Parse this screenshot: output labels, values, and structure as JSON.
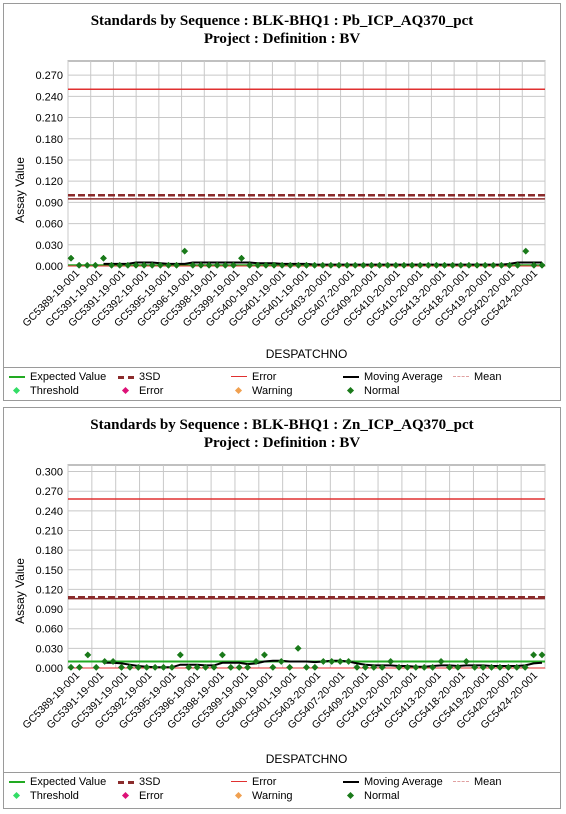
{
  "legend": {
    "expected_value": "Expected Value",
    "three_sd": "3SD",
    "error_line": "Error",
    "moving_average": "Moving Average",
    "mean": "Mean",
    "threshold": "Threshold",
    "error_marker": "Error",
    "warning": "Warning",
    "normal": "Normal"
  },
  "colors": {
    "expected_value": "#22aa22",
    "three_sd": "#8b2c2c",
    "error_line": "#e03030",
    "moving_average": "#000000",
    "mean": "#e0a0a0",
    "threshold": "#33dd66",
    "error_marker": "#dd1177",
    "warning": "#f0a050",
    "normal": "#1a7a1a"
  },
  "charts": [
    {
      "title_line1": "Standards by Sequence : BLK-BHQ1 : Pb_ICP_AQ370_pct",
      "title_line2": "Project : Definition : BV"
    },
    {
      "title_line1": "Standards by Sequence : BLK-BHQ1 : Zn_ICP_AQ370_pct",
      "title_line2": "Project : Definition : BV"
    }
  ],
  "chart_data": [
    {
      "type": "line",
      "title": "Standards by Sequence : BLK-BHQ1 : Pb_ICP_AQ370_pct",
      "subtitle": "Project : Definition : BV",
      "xlabel": "DESPATCHNO",
      "ylabel": "Assay Value",
      "ylim": [
        0,
        0.29
      ],
      "yticks": [
        "0.000",
        "0.030",
        "0.060",
        "0.090",
        "0.120",
        "0.150",
        "0.180",
        "0.210",
        "0.240",
        "0.270"
      ],
      "x_tick_labels": [
        "GC5389-19-001",
        "GC5391-19-001",
        "GC5391-19-001",
        "GC5392-19-001",
        "GC5395-19-001",
        "GC5396-19-001",
        "GC5398-19-001",
        "GC5399-19-001",
        "GC5400-19-001",
        "GC5401-19-001",
        "GC5401-19-001",
        "GC5403-20-001",
        "GC5407-20-001",
        "GC5409-20-001",
        "GC5410-20-001",
        "GC5410-20-001",
        "GC5413-20-001",
        "GC5418-20-001",
        "GC5419-20-001",
        "GC5420-20-001",
        "GC5424-20-001"
      ],
      "grid": true,
      "legend_position": "bottom",
      "reference_lines": {
        "expected_value": 0.001,
        "three_sd_upper": 0.1,
        "three_sd_lower": 0.095,
        "error": 0.25
      },
      "series": [
        {
          "name": "Normal",
          "values": [
            0.011,
            0.001,
            0.001,
            0.001,
            0.011,
            0.001,
            0.001,
            0.001,
            0.001,
            0.001,
            0.001,
            0.001,
            0.001,
            0.001,
            0.021,
            0.001,
            0.001,
            0.001,
            0.001,
            0.001,
            0.001,
            0.011,
            0.001,
            0.001,
            0.001,
            0.001,
            0.001,
            0.001,
            0.001,
            0.001,
            0.001,
            0.001,
            0.001,
            0.001,
            0.001,
            0.001,
            0.001,
            0.001,
            0.001,
            0.001,
            0.001,
            0.001,
            0.001,
            0.001,
            0.001,
            0.001,
            0.001,
            0.001,
            0.001,
            0.001,
            0.001,
            0.001,
            0.001,
            0.001,
            0.001,
            0.001,
            0.021,
            0.001,
            0.001
          ]
        },
        {
          "name": "Moving Average",
          "values": [
            null,
            null,
            null,
            null,
            0.003,
            0.003,
            0.003,
            0.003,
            0.005,
            0.005,
            0.005,
            0.004,
            0.003,
            0.003,
            0.003,
            0.005,
            0.005,
            0.005,
            0.005,
            0.005,
            0.005,
            0.005,
            0.005,
            0.004,
            0.004,
            0.004,
            0.003,
            0.003,
            0.003,
            0.003,
            0.002,
            0.002,
            0.002,
            0.002,
            0.002,
            0.002,
            0.002,
            0.002,
            0.002,
            0.002,
            0.002,
            0.002,
            0.002,
            0.002,
            0.002,
            0.002,
            0.002,
            0.002,
            0.002,
            0.002,
            0.002,
            0.002,
            0.002,
            0.002,
            0.003,
            0.005,
            0.005,
            0.005,
            0.005
          ]
        }
      ]
    },
    {
      "type": "line",
      "title": "Standards by Sequence : BLK-BHQ1 : Zn_ICP_AQ370_pct",
      "subtitle": "Project : Definition : BV",
      "xlabel": "DESPATCHNO",
      "ylabel": "Assay Value",
      "ylim": [
        0,
        0.31
      ],
      "yticks": [
        "0.000",
        "0.030",
        "0.060",
        "0.090",
        "0.120",
        "0.150",
        "0.180",
        "0.210",
        "0.240",
        "0.270",
        "0.300"
      ],
      "x_tick_labels": [
        "GC5389-19-001",
        "GC5391-19-001",
        "GC5391-19-001",
        "GC5392-19-001",
        "GC5395-19-001",
        "GC5396-19-001",
        "GC5398-19-001",
        "GC5399-19-001",
        "GC5400-19-001",
        "GC5401-19-001",
        "GC5403-20-001",
        "GC5407-20-001",
        "GC5409-20-001",
        "GC5410-20-001",
        "GC5410-20-001",
        "GC5413-20-001",
        "GC5418-20-001",
        "GC5419-20-001",
        "GC5420-20-001",
        "GC5424-20-001"
      ],
      "grid": true,
      "legend_position": "bottom",
      "reference_lines": {
        "expected_value": 0.01,
        "three_sd_upper": 0.108,
        "three_sd_lower": 0.106,
        "error": 0.258
      },
      "series": [
        {
          "name": "Normal",
          "values": [
            0.001,
            0.001,
            0.02,
            0.001,
            0.01,
            0.01,
            0.001,
            0.001,
            0.001,
            0.001,
            0.001,
            0.001,
            0.001,
            0.02,
            0.001,
            0.001,
            0.001,
            0.001,
            0.02,
            0.001,
            0.001,
            0.001,
            0.01,
            0.02,
            0.001,
            0.01,
            0.001,
            0.03,
            0.001,
            0.001,
            0.01,
            0.01,
            0.01,
            0.01,
            0.001,
            0.001,
            0.001,
            0.001,
            0.01,
            0.001,
            0.001,
            0.001,
            0.001,
            0.001,
            0.01,
            0.001,
            0.001,
            0.01,
            0.001,
            0.001,
            0.001,
            0.001,
            0.001,
            0.001,
            0.001,
            0.02,
            0.02
          ]
        },
        {
          "name": "Moving Average",
          "values": [
            null,
            null,
            null,
            null,
            0.008,
            0.008,
            0.007,
            0.005,
            0.003,
            0.002,
            0.001,
            0.001,
            0.001,
            0.005,
            0.005,
            0.005,
            0.004,
            0.004,
            0.008,
            0.008,
            0.008,
            0.006,
            0.007,
            0.01,
            0.011,
            0.011,
            0.01,
            0.01,
            0.01,
            0.009,
            0.01,
            0.011,
            0.011,
            0.01,
            0.007,
            0.005,
            0.004,
            0.004,
            0.004,
            0.003,
            0.003,
            0.002,
            0.002,
            0.003,
            0.004,
            0.004,
            0.003,
            0.004,
            0.004,
            0.004,
            0.003,
            0.003,
            0.003,
            0.003,
            0.004,
            0.007,
            0.008
          ]
        }
      ]
    }
  ]
}
